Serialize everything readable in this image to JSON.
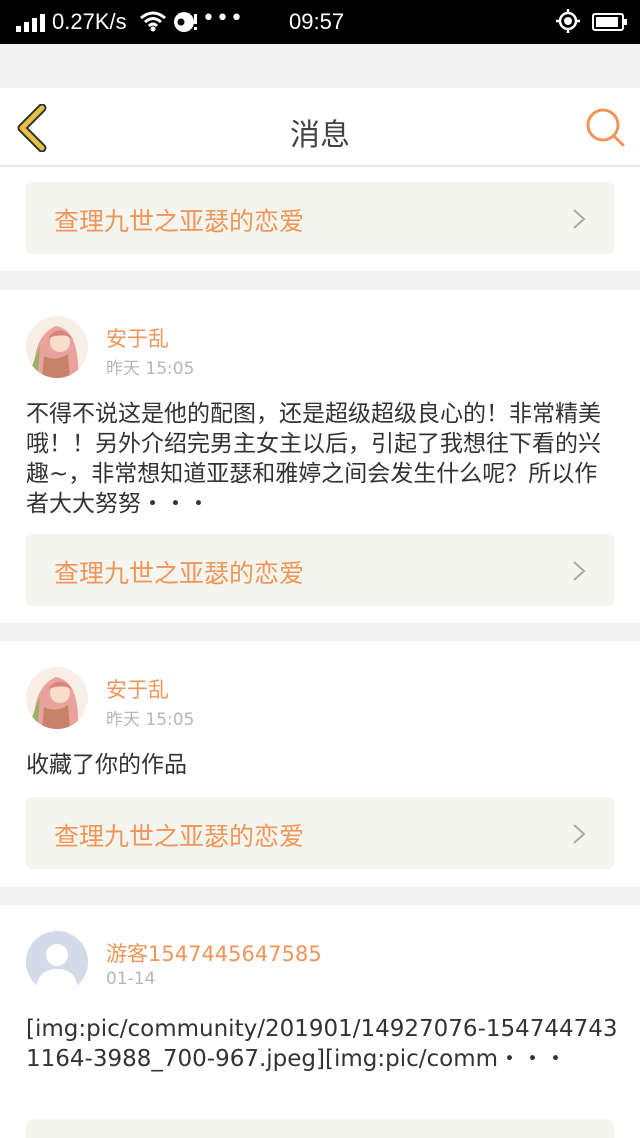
{
  "status_bar": {
    "speed": "0.27K/s",
    "time": "09:57",
    "more": "•••"
  },
  "header": {
    "title": "消息"
  },
  "colors": {
    "accent": "#f0955a",
    "back_icon": "#e8c040",
    "card_bg": "#ffffff",
    "link_bg": "#f5f5f0"
  },
  "messages": [
    {
      "work_title": "查理九世之亚瑟的恋爱"
    },
    {
      "user": "安于乱",
      "time": "昨天 15:05",
      "content": "不得不说这是他的配图，还是超级超级良心的！非常精美哦！！另外介绍完男主女主以后，引起了我想往下看的兴趣~，非常想知道亚瑟和雅婷之间会发生什么呢？所以作者大大努努・・・",
      "work_title": "查理九世之亚瑟的恋爱",
      "avatar_icon": "anime-girl-avatar"
    },
    {
      "user": "安于乱",
      "time": "昨天 15:05",
      "content": "收藏了你的作品",
      "work_title": "查理九世之亚瑟的恋爱",
      "avatar_icon": "anime-girl-avatar"
    },
    {
      "user": "游客1547445647585",
      "time": "01-14",
      "content": "[img:pic/community/201901/14927076-1547447431164-3988_700-967.jpeg][img:pic/comm・・・",
      "avatar_icon": "default-user-avatar"
    }
  ]
}
